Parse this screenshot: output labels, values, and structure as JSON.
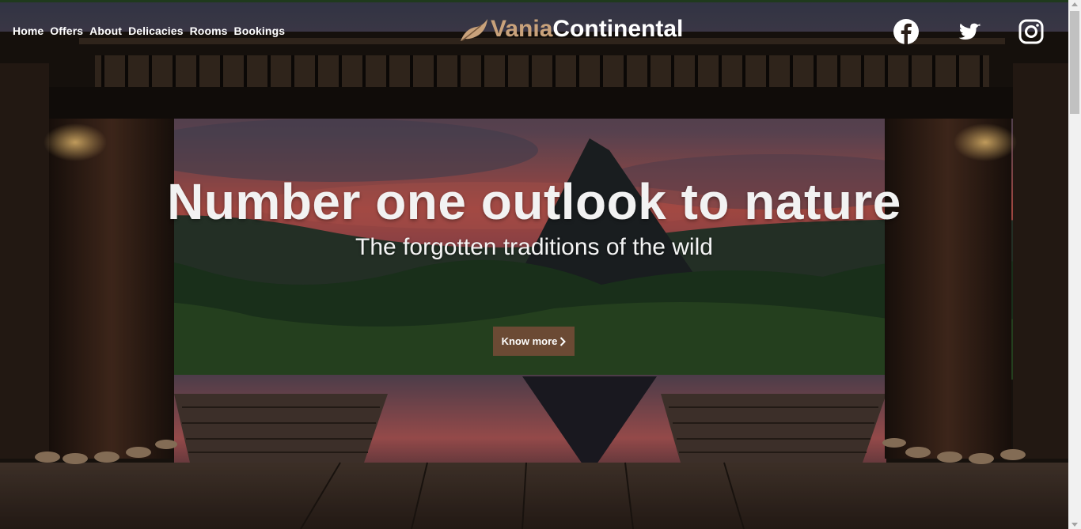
{
  "nav": {
    "links": [
      "Home",
      "Offers",
      "About",
      "Delicacies",
      "Rooms",
      "Bookings"
    ]
  },
  "brand": {
    "part1": "Vania",
    "part2": "Continental",
    "icon": "leaf-logo-icon",
    "accent_color": "#c9a27b"
  },
  "social": [
    "facebook-icon",
    "twitter-icon",
    "instagram-icon"
  ],
  "hero": {
    "title": "Number one outlook to nature",
    "subtitle": "The forgotten traditions of the wild",
    "cta_label": "Know more",
    "cta_icon": "chevron-right-icon",
    "cta_color": "#6b4a34"
  }
}
